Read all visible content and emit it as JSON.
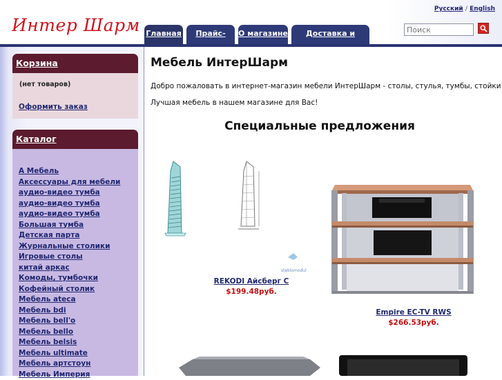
{
  "header": {
    "logo": "Интер Шарм",
    "lang_ru": "Русский",
    "lang_sep": "/",
    "lang_en": "English",
    "search_placeholder": "Поиск"
  },
  "nav": {
    "tabs": [
      "Главная",
      "Прайс-лист",
      "О магазине",
      "Доставка и оплата"
    ]
  },
  "cart": {
    "title": "Корзина",
    "empty": "(нет товаров)",
    "order_link": "Оформить заказ"
  },
  "catalog": {
    "title": "Каталог",
    "items": [
      "А Мебель",
      "Аксессуары для мебели",
      "аудио-видео тумба",
      "аудио-видео тумба",
      "аудио-видео тумба",
      "Большая тумба",
      "Детская парта",
      "Журнальные столики",
      "Игровые столы",
      "китай аркас",
      "Комоды, тумбочки",
      "Кофейный столик",
      "Мебель ateca",
      "Мебель bdi",
      "Мебель bell'o",
      "Мебель bello",
      "Мебель belsis",
      "Мебель ultimate",
      "Мебель артстоун",
      "Мебель Империя"
    ]
  },
  "main": {
    "title": "Мебель ИнтерШарм",
    "welcome": "Добро пожаловать в интернет-магазин мебели ИнтерШарм - столы, стулья, тумбы, стойки",
    "best": "Лучшая мебель в нашем магазине для Вас!",
    "special_title": "Специальные предложения",
    "products": [
      {
        "name": "REKODI Айсберг C",
        "price": "$199.48руб.",
        "watermark": "steklomodul"
      },
      {
        "name": "Empire EC-TV RWS",
        "price": "$266.53руб."
      }
    ]
  },
  "colors": {
    "logo": "#d0141e",
    "nav": "#2e3a78",
    "box_head": "#5c1b2e",
    "link": "#1f2770",
    "price": "#c41010"
  }
}
